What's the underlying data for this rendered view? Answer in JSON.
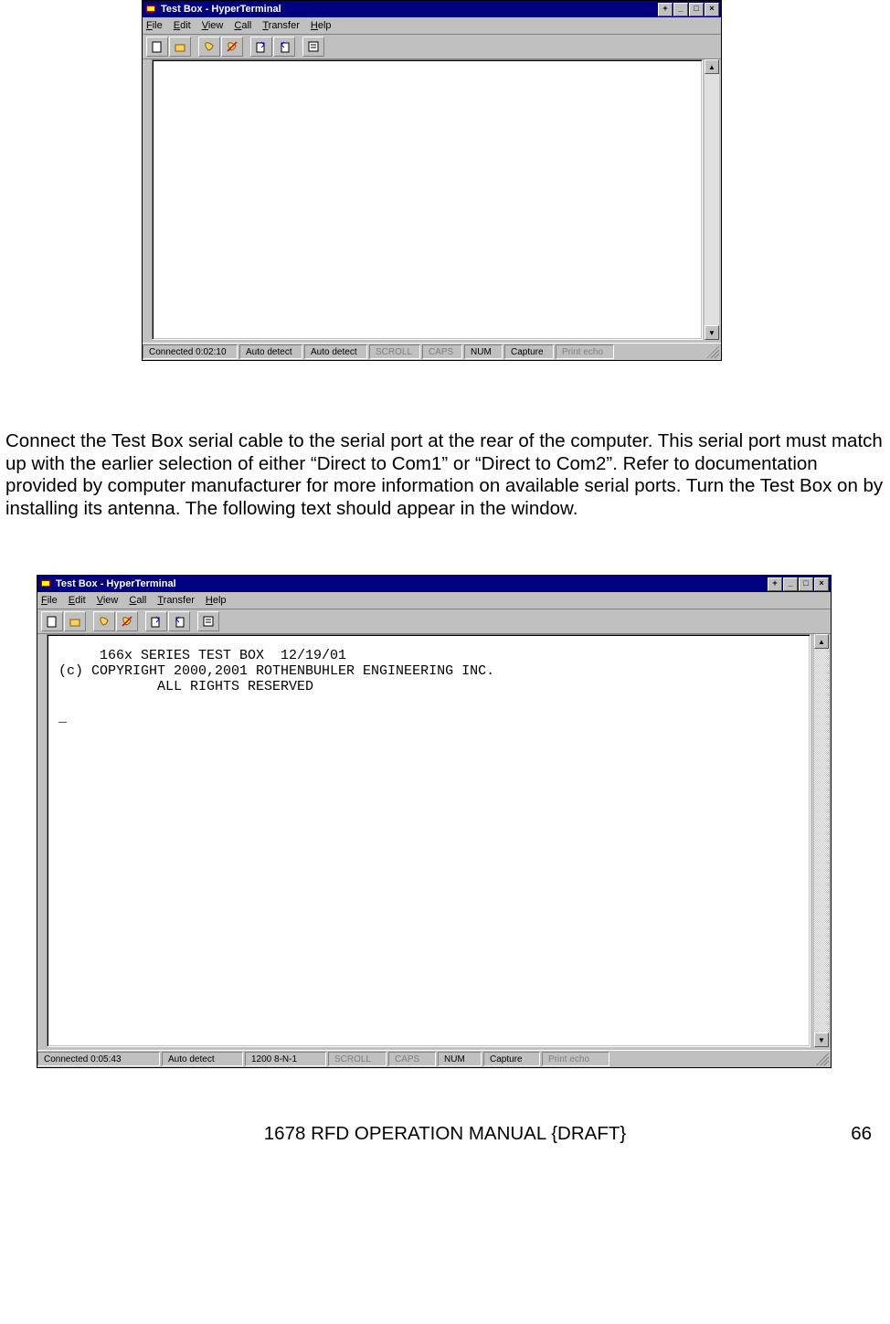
{
  "shot1": {
    "title": "Test Box - HyperTerminal",
    "menus": [
      "File",
      "Edit",
      "View",
      "Call",
      "Transfer",
      "Help"
    ],
    "terminal_content": "",
    "status": {
      "connected": "Connected 0:02:10",
      "detect1": "Auto detect",
      "detect2": "Auto detect",
      "scroll": "SCROLL",
      "caps": "CAPS",
      "num": "NUM",
      "capture": "Capture",
      "printecho": "Print echo"
    }
  },
  "body_text": "Connect the Test Box serial cable to the serial port at the rear of the computer.  This serial port must match up with the earlier selection of either “Direct to Com1” or “Direct to Com2”.  Refer to documentation provided by computer manufacturer for more information on available serial ports.  Turn the Test Box on by installing its antenna.  The following text should appear in the window.",
  "shot2": {
    "title": "Test Box - HyperTerminal",
    "menus": [
      "File",
      "Edit",
      "View",
      "Call",
      "Transfer",
      "Help"
    ],
    "terminal_content": "     166x SERIES TEST BOX  12/19/01\n(c) COPYRIGHT 2000,2001 ROTHENBUHLER ENGINEERING INC.\n            ALL RIGHTS RESERVED\n\n_",
    "status": {
      "connected": "Connected 0:05:43",
      "detect1": "Auto detect",
      "detect2": "1200 8-N-1",
      "scroll": "SCROLL",
      "caps": "CAPS",
      "num": "NUM",
      "capture": "Capture",
      "printecho": "Print echo"
    }
  },
  "footer": {
    "title": "1678 RFD OPERATION MANUAL {DRAFT}",
    "page": "66"
  }
}
